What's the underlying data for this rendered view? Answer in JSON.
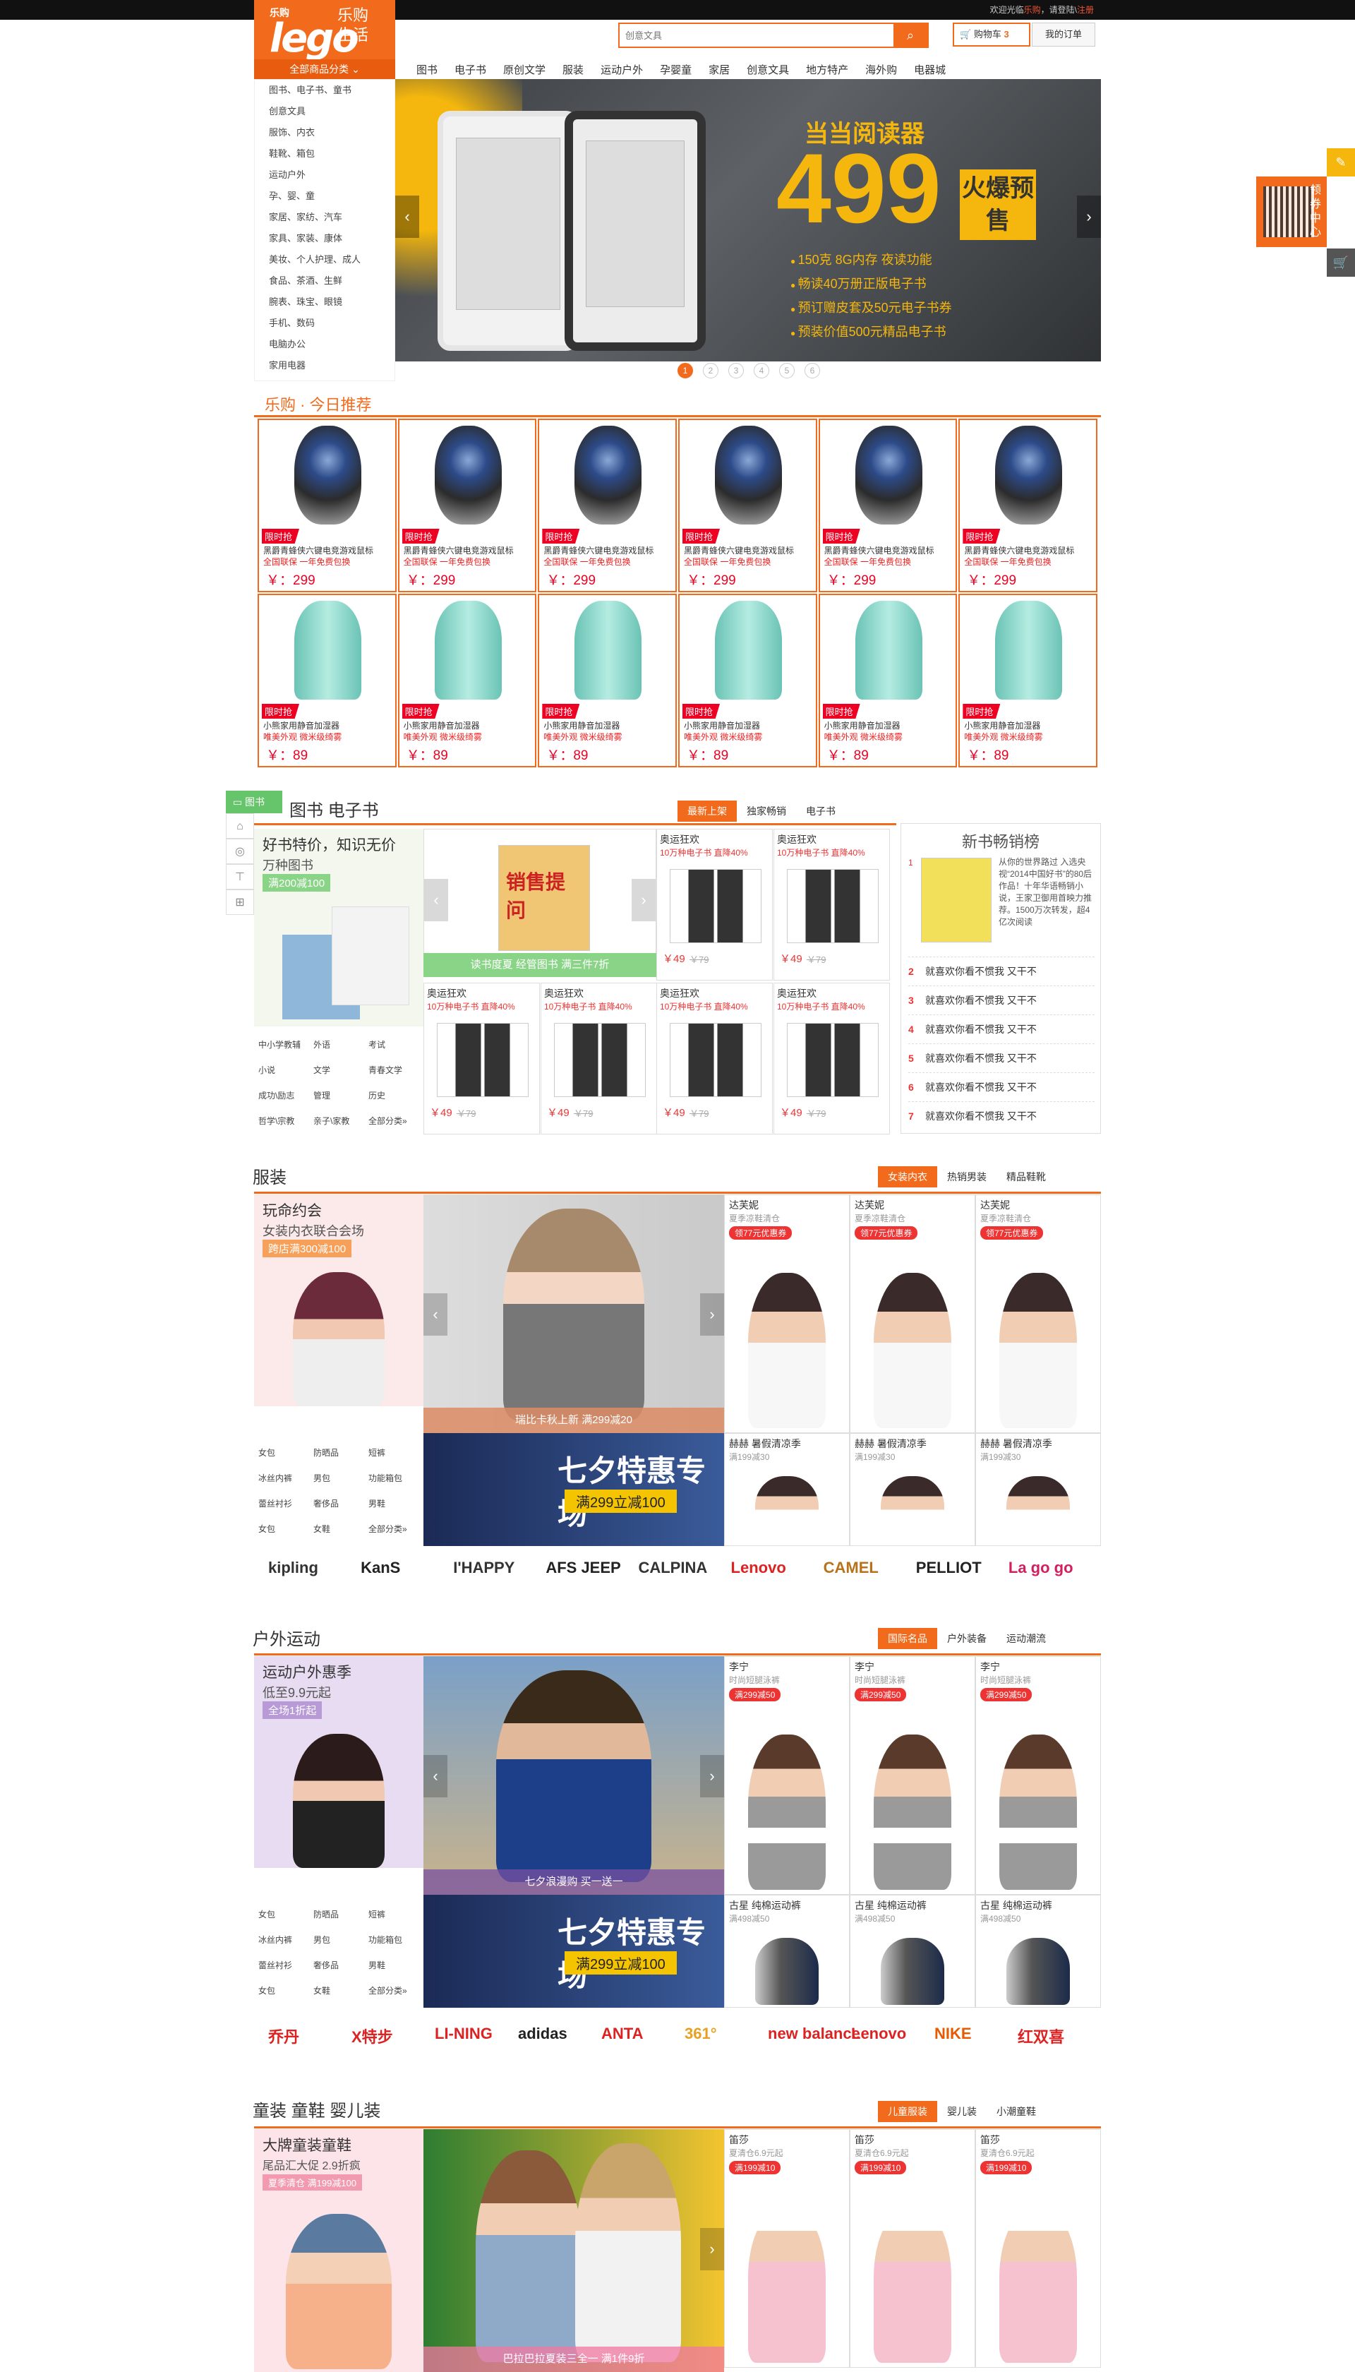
{
  "topbar": {
    "welcome": "欢迎光临",
    "site": "乐购",
    "sep1": "，请",
    "login": "登陆",
    "sep2": "\\",
    "register": "注册"
  },
  "logo": {
    "cn": "乐购",
    "en": "lego",
    "sub": "乐购生活"
  },
  "header": {
    "all_cats": "全部商品分类",
    "search_placeholder": "创意文具",
    "cart_label": "购物车",
    "cart_count": "3",
    "orders_label": "我的订单"
  },
  "nav": [
    "图书",
    "电子书",
    "原创文学",
    "服装",
    "运动户外",
    "孕婴童",
    "家居",
    "创意文具",
    "地方特产",
    "海外购",
    "电器城"
  ],
  "categories": [
    "图书、电子书、童书",
    "创意文具",
    "服饰、内衣",
    "鞋靴、箱包",
    "运动户外",
    "孕、婴、童",
    "家居、家纺、汽车",
    "家具、家装、康体",
    "美妆、个人护理、成人",
    "食品、茶酒、生鲜",
    "腕表、珠宝、眼镜",
    "手机、数码",
    "电脑办公",
    "家用电器"
  ],
  "banner": {
    "title": "当当阅读器",
    "price": "499",
    "tag": "火爆预售",
    "bullets": [
      "150克 8G内存 夜读功能",
      "畅读40万册正版电子书",
      "预订赠皮套及50元电子书券",
      "预装价值500元精品电子书"
    ],
    "dots": [
      "1",
      "2",
      "3",
      "4",
      "5",
      "6"
    ],
    "active_dot": 0
  },
  "float": {
    "qr_text": "领券中心"
  },
  "today": {
    "title": "乐购 · 今日推荐",
    "flag": "限时抢",
    "mouse": {
      "name": "黑爵青蜂侠六键电竞游戏鼠标",
      "sub": "全国联保 一年免费包换",
      "price": "￥：299"
    },
    "humid": {
      "name": "小熊家用静音加湿器",
      "sub": "唯美外观 微米级绮雾",
      "price": "￥：89"
    }
  },
  "books": {
    "side_label": "图书",
    "title": "图书  电子书",
    "tabs": [
      "最新上架",
      "独家畅销",
      "电子书"
    ],
    "promo": {
      "t1": "好书特价，知识无价",
      "t2": "万种图书",
      "tag": "满200减100"
    },
    "links": [
      "中小学教辅",
      "外语",
      "考试",
      "小说",
      "文学",
      "青春文学",
      "成功\\励志",
      "管理",
      "历史",
      "哲学\\宗教",
      "亲子\\家教",
      "全部分类»"
    ],
    "mid_title": "销售提问",
    "mid_cap": "读书度夏 经管图书 满三件7折",
    "cell": {
      "name": "奥运狂欢",
      "sub": "10万种电子书 直降40%",
      "price": "￥49",
      "old": "￥79"
    },
    "rank": {
      "title": "新书畅销榜",
      "top_text": "从你的世界路过 入选央视“2014中国好书”的80后作品！十年华语畅销小说，王家卫御用首映力推荐。1500万次转发，超4亿次阅读",
      "row": "就喜欢你看不惯我  又干不",
      "nums": [
        "1",
        "2",
        "3",
        "4",
        "5",
        "6",
        "7"
      ]
    }
  },
  "fashion": {
    "title": "服装",
    "tabs": [
      "女装内衣",
      "热销男装",
      "精品鞋靴"
    ],
    "promo": {
      "t1": "玩命约会",
      "t2": "女装内衣联合会场",
      "tag": "跨店满300减100"
    },
    "links": [
      "女包",
      "防晒品",
      "短裤",
      "冰丝内裤",
      "男包",
      "功能箱包",
      "蕾丝衬衫",
      "奢侈品",
      "男鞋",
      "女包",
      "女鞋",
      "全部分类»"
    ],
    "mid_cap": "瑞比卡秋上新 满299减20",
    "mid2": "七夕特惠专场",
    "mid2_sub": "满299立减100",
    "cellA": {
      "name": "达芙妮",
      "sub": "夏季凉鞋清仓",
      "badge": "领77元优惠券"
    },
    "cellB": {
      "name": "赫赫 暑假清凉季",
      "sub": "满199减30"
    },
    "brands": [
      "kipling",
      "KanS",
      "I'HAPPY",
      "AFS JEEP",
      "CALPINA",
      "Lenovo",
      "CAMEL",
      "PELLIOT",
      "La go go"
    ]
  },
  "outdoor": {
    "title": "户外运动",
    "tabs": [
      "国际名品",
      "户外装备",
      "运动潮流"
    ],
    "promo": {
      "t1": "运动户外惠季",
      "t2": "低至9.9元起",
      "tag": "全场1折起"
    },
    "mid_cap": "七夕浪漫购 买一送一",
    "cellA": {
      "name": "李宁",
      "sub": "时尚短腿泳裤",
      "badge": "满299减50"
    },
    "cellB": {
      "name": "古星 纯棉运动裤",
      "sub": "满498减50"
    },
    "brands": [
      "乔丹",
      "X特步",
      "LI-NING",
      "adidas",
      "ANTA",
      "361°",
      "new balance",
      "Lenovo",
      "NIKE",
      "红双喜"
    ]
  },
  "kids": {
    "title": "童装  童鞋  婴儿装",
    "tabs": [
      "儿童服装",
      "婴儿装",
      "小潮童鞋"
    ],
    "promo": {
      "t1": "大牌童装童鞋",
      "t2": "尾品汇大促 2.9折疯",
      "tag": "夏季清仓 满199减100"
    },
    "mid_cap": "巴拉巴拉夏装三全一 满1件9折",
    "cellA": {
      "name": "笛莎",
      "sub": "夏清仓6.9元起",
      "badge": "满199减10"
    }
  },
  "colors": {
    "brand": "#f26a1b",
    "price": "#e02222",
    "green": "#66c46a"
  }
}
